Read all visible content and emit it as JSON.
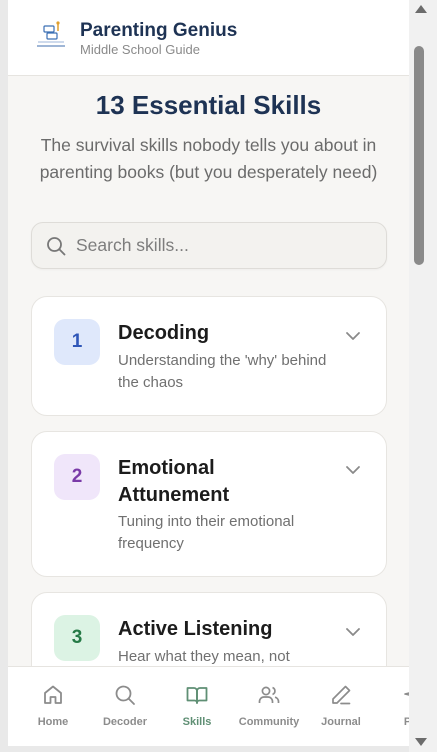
{
  "header": {
    "title": "Parenting Genius",
    "subtitle": "Middle School Guide"
  },
  "hero": {
    "title": "13 Essential Skills",
    "subtitle": "The survival skills nobody tells you about in parenting books (but you desperately need)"
  },
  "search": {
    "placeholder": "Search skills..."
  },
  "skills": [
    {
      "number": "1",
      "title": "Decoding",
      "description": "Understanding the 'why' behind the chaos",
      "badge_bg": "#dfe8fb",
      "badge_color": "#2f56b8"
    },
    {
      "number": "2",
      "title": "Emotional Attunement",
      "description": "Tuning into their emotional frequency",
      "badge_bg": "#f0e6fa",
      "badge_color": "#7a3aa8"
    },
    {
      "number": "3",
      "title": "Active Listening",
      "description": "Hear what they mean, not",
      "badge_bg": "#dcf3e4",
      "badge_color": "#257a46"
    }
  ],
  "nav": [
    {
      "label": "Home",
      "icon": "home-icon"
    },
    {
      "label": "Decoder",
      "icon": "search-icon"
    },
    {
      "label": "Skills",
      "icon": "book-icon",
      "active": true
    },
    {
      "label": "Community",
      "icon": "users-icon"
    },
    {
      "label": "Journal",
      "icon": "pen-icon"
    },
    {
      "label": "Pro",
      "icon": "sparkle-icon"
    }
  ],
  "colors": {
    "brand": "#1e3354",
    "active_nav": "#5f8f74"
  }
}
